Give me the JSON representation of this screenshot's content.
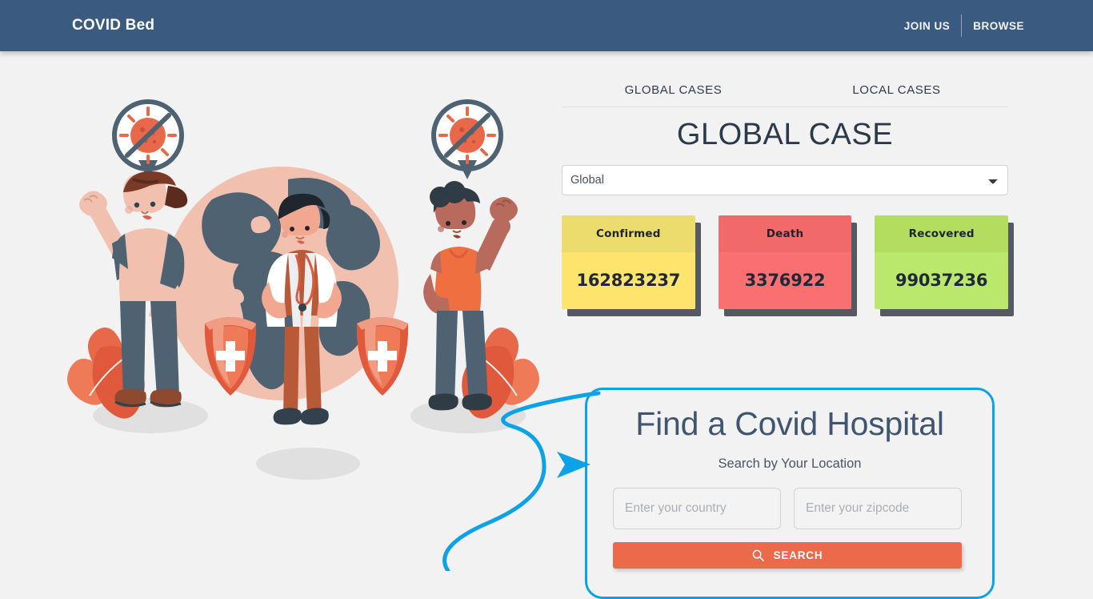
{
  "navbar": {
    "brand": "COVID Bed",
    "links": [
      {
        "label": "JOIN US",
        "name": "join-us"
      },
      {
        "label": "BROWSE",
        "name": "browse"
      }
    ]
  },
  "tabs": [
    {
      "label": "GLOBAL CASES",
      "active": true
    },
    {
      "label": "LOCAL CASES",
      "active": false
    }
  ],
  "cases_panel": {
    "title": "GLOBAL CASE",
    "region_select": {
      "value": "Global",
      "options": [
        "Global"
      ]
    },
    "stats": [
      {
        "label": "Confirmed",
        "value": "162823237",
        "head_color": "#ecdc6d",
        "body_color": "#fde46c"
      },
      {
        "label": "Death",
        "value": "3376922",
        "head_color": "#f2696a",
        "body_color": "#fa6f6f"
      },
      {
        "label": "Recovered",
        "value": "99037236",
        "head_color": "#b2dd5f",
        "body_color": "#bae86d"
      }
    ]
  },
  "find_panel": {
    "title": "Find a Covid Hospital",
    "subtitle": "Search by Your Location",
    "country_input": {
      "value": "",
      "placeholder": "Enter your country"
    },
    "zipcode_input": {
      "value": "",
      "placeholder": "Enter your zipcode"
    },
    "search_button": "SEARCH",
    "border_color": "#0ca2e8",
    "button_color": "#ec6a4c"
  },
  "theme": {
    "navbar_color": "#3b5a80",
    "page_background": "#f2f2f2",
    "accent_blue": "#0ca2e8",
    "accent_orange": "#ec6a4c"
  },
  "illustration": {
    "alt": "people-with-globe-and-doctor-covid-illustration"
  }
}
